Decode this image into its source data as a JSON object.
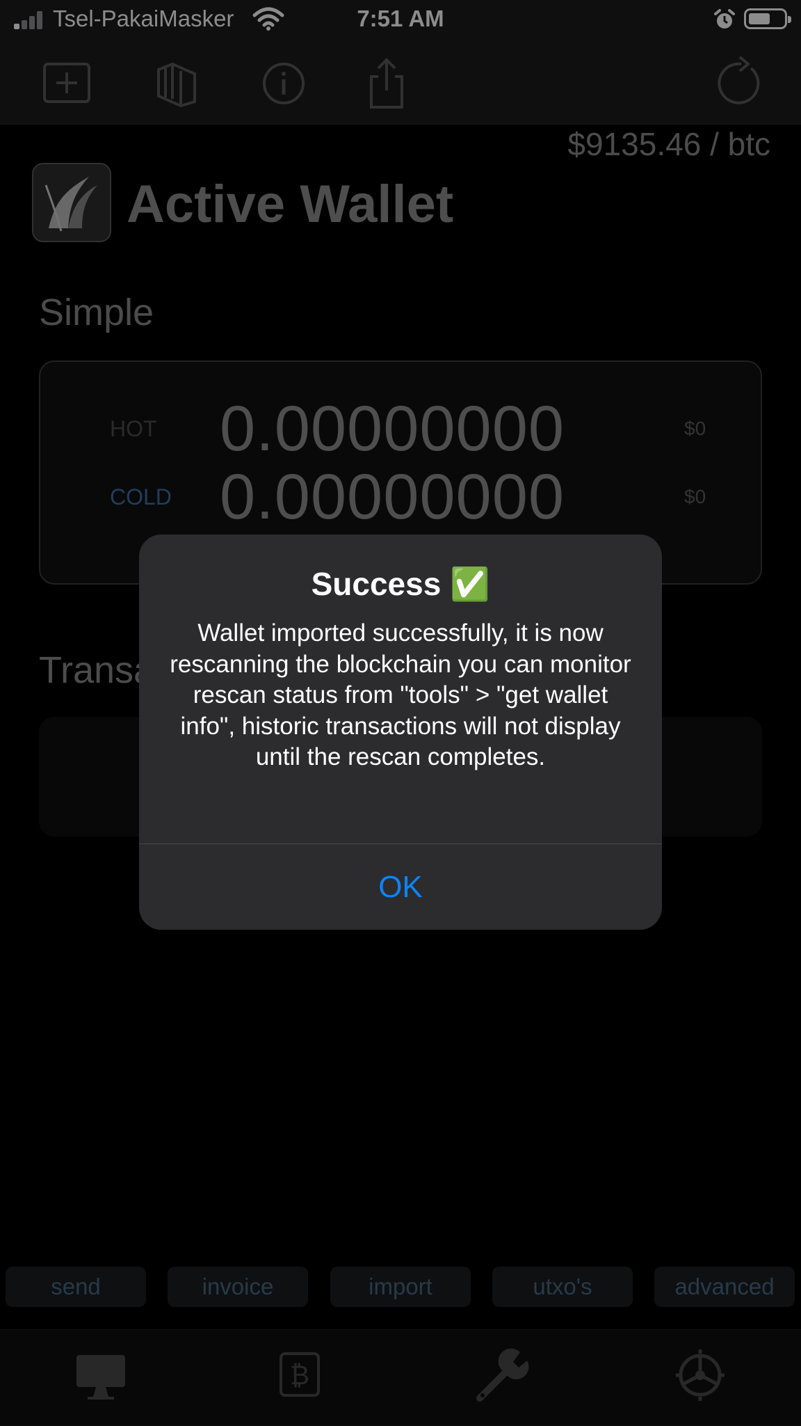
{
  "status_bar": {
    "carrier": "Tsel-PakaiMasker",
    "time": "7:51 AM",
    "icons": [
      "signal-icon",
      "wifi-icon",
      "alarm-icon",
      "battery-icon"
    ]
  },
  "toolbar": {
    "icons": [
      "add-wallet-icon",
      "wallets-icon",
      "info-icon",
      "share-icon",
      "refresh-icon"
    ]
  },
  "main": {
    "price": "$9135.46 / btc",
    "title": "Active Wallet",
    "section_simple": "Simple",
    "balances": {
      "hot_label": "HOT",
      "hot_amount": "0.00000000",
      "hot_fiat": "$0",
      "cold_label": "COLD",
      "cold_amount": "0.00000000",
      "cold_fiat": "$0"
    },
    "section_transactions": "Transactions"
  },
  "alert": {
    "title": "Success ✅",
    "message": "Wallet imported successfully, it is now rescanning the blockchain you can monitor rescan status from \"tools\" > \"get wallet info\", historic transactions will not display until the rescan completes.",
    "ok_label": "OK"
  },
  "actions": [
    "send",
    "invoice",
    "import",
    "utxo's",
    "advanced"
  ],
  "tabbar": {
    "icons": [
      "desktop-icon",
      "bitcoin-icon",
      "wrench-icon",
      "settings-wheel-icon"
    ]
  },
  "colors": {
    "accent": "#0a84ff",
    "cold_label": "#3e6fa8",
    "hot_label": "#4e4e4e",
    "background": "#000000"
  }
}
